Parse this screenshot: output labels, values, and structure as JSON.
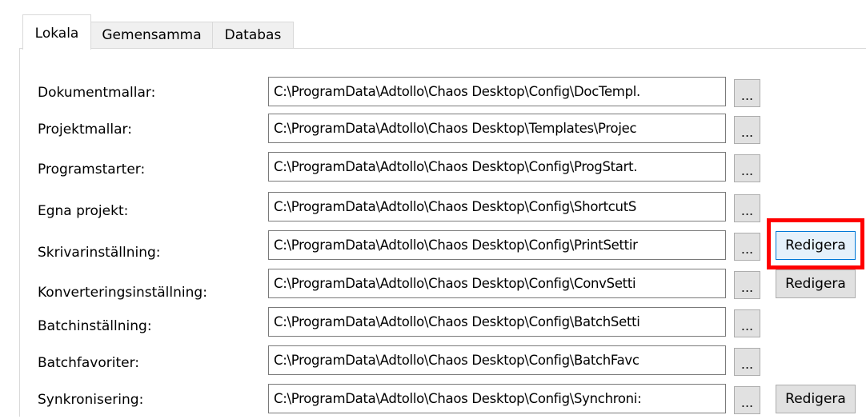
{
  "tabs": [
    {
      "label": "Lokala",
      "active": true
    },
    {
      "label": "Gemensamma",
      "active": false
    },
    {
      "label": "Databas",
      "active": false
    }
  ],
  "rows": [
    {
      "label": "Dokumentmallar:",
      "path": "C:\\ProgramData\\Adtollo\\Chaos Desktop\\Config\\DocTempl.",
      "browse": "...",
      "edit": ""
    },
    {
      "label": "Projektmallar:",
      "path": "C:\\ProgramData\\Adtollo\\Chaos Desktop\\Templates\\Projec",
      "browse": "...",
      "edit": ""
    },
    {
      "label": "Programstarter:",
      "path": "C:\\ProgramData\\Adtollo\\Chaos Desktop\\Config\\ProgStart.",
      "browse": "...",
      "edit": ""
    },
    {
      "label": "Egna projekt:",
      "path": "C:\\ProgramData\\Adtollo\\Chaos Desktop\\Config\\ShortcutS",
      "browse": "...",
      "edit": ""
    },
    {
      "label": "Skrivarinställning:",
      "path": "C:\\ProgramData\\Adtollo\\Chaos Desktop\\Config\\PrintSettir",
      "browse": "...",
      "edit": "Redigera"
    },
    {
      "label": "Konverteringsinställning:",
      "path": "C:\\ProgramData\\Adtollo\\Chaos Desktop\\Config\\ConvSetti",
      "browse": "...",
      "edit": "Redigera"
    },
    {
      "label": "Batchinställning:",
      "path": "C:\\ProgramData\\Adtollo\\Chaos Desktop\\Config\\BatchSetti",
      "browse": "...",
      "edit": ""
    },
    {
      "label": "Batchfavoriter:",
      "path": "C:\\ProgramData\\Adtollo\\Chaos Desktop\\Config\\BatchFavc",
      "browse": "...",
      "edit": ""
    },
    {
      "label": "Synkronisering:",
      "path": "C:\\ProgramData\\Adtollo\\Chaos Desktop\\Config\\Synchroni:",
      "browse": "...",
      "edit": "Redigera"
    }
  ],
  "colors": {
    "highlight": "#ff0000",
    "focus_border": "#0078d7"
  }
}
